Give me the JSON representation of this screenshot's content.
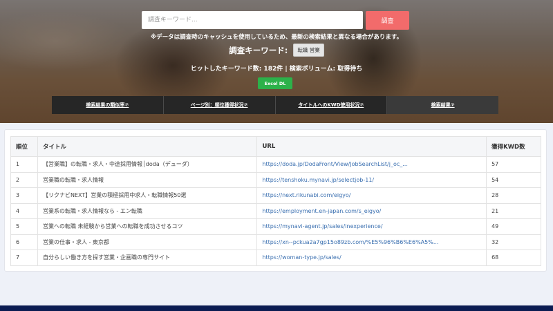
{
  "search": {
    "placeholder": "調査キーワード...",
    "button_label": "調査"
  },
  "notice": "※データは調査時のキャッシュを使用しているため、最新の検索結果と異なる場合があります。",
  "keyword": {
    "label": "調査キーワード:",
    "value": "転職 営業"
  },
  "stats": "ヒットしたキーワード数: 182件 | 検索ボリューム: 取得待ち",
  "excel_button": "Excel DL",
  "tabs": [
    {
      "label": "検索結果の類似率⑦"
    },
    {
      "label": "ページ別：順位獲得状況⑦"
    },
    {
      "label": "タイトルへのKWD使用状況⑦"
    },
    {
      "label": "検索結果⑦"
    }
  ],
  "table": {
    "headers": [
      "順位",
      "タイトル",
      "URL",
      "獲得KWD数"
    ],
    "rows": [
      {
        "rank": "1",
        "title": "【営業職】の転職・求人・中途採用情報│doda（デューダ）",
        "url": "https://doda.jp/DodaFront/View/JobSearchList/j_oc_...",
        "kwd": "57"
      },
      {
        "rank": "2",
        "title": "営業職の転職・求人情報",
        "url": "https://tenshoku.mynavi.jp/selectjob-11/",
        "kwd": "54"
      },
      {
        "rank": "3",
        "title": "【リクナビNEXT】営業の積極採用中求人・転職情報50選",
        "url": "https://next.rikunabi.com/eigyo/",
        "kwd": "28"
      },
      {
        "rank": "4",
        "title": "営業系の転職・求人情報なら - エン転職",
        "url": "https://employment.en-japan.com/s_eigyo/",
        "kwd": "21"
      },
      {
        "rank": "5",
        "title": "営業への転職 未経験から営業への転職を成功させるコツ",
        "url": "https://mynavi-agent.jp/sales/inexperience/",
        "kwd": "49"
      },
      {
        "rank": "6",
        "title": "営業の仕事・求人 - 東京都",
        "url": "https://xn--pckua2a7gp15o89zb.com/%E5%96%B6%E6%A5%...",
        "kwd": "32"
      },
      {
        "rank": "7",
        "title": "自分らしい働き方を探す営業・企画職の専門サイト",
        "url": "https://woman-type.jp/sales/",
        "kwd": "68"
      }
    ]
  }
}
